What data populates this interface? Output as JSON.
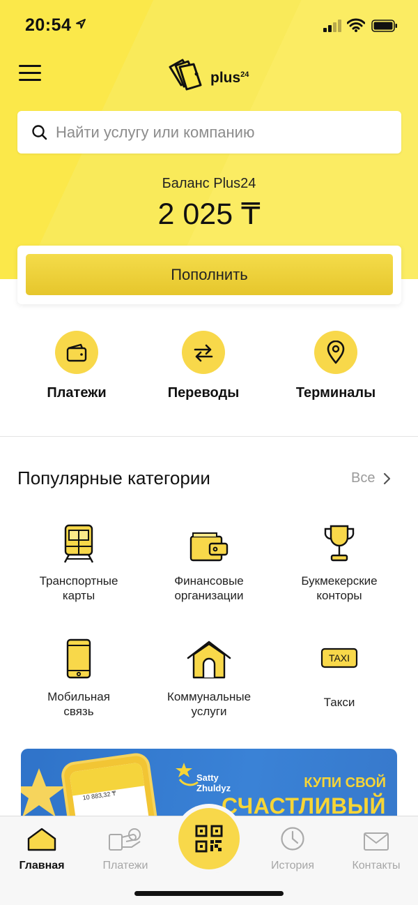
{
  "status_bar": {
    "time": "20:54"
  },
  "header": {
    "logo_text": "plus",
    "logo_sup": "24"
  },
  "search": {
    "placeholder": "Найти услугу или компанию",
    "value": ""
  },
  "balance": {
    "label": "Баланс Plus24",
    "amount": "2 025 ₸"
  },
  "topup": {
    "label": "Пополнить"
  },
  "quick_actions": [
    {
      "label": "Платежи",
      "icon": "wallet-icon"
    },
    {
      "label": "Переводы",
      "icon": "transfer-arrows-icon"
    },
    {
      "label": "Терминалы",
      "icon": "location-pin-icon"
    }
  ],
  "popular": {
    "title": "Популярные категории",
    "see_all": "Все",
    "items": [
      {
        "line1": "Транспортные",
        "line2": "карты",
        "icon": "train-icon"
      },
      {
        "line1": "Финансовые",
        "line2": "организации",
        "icon": "wallet-icon"
      },
      {
        "line1": "Букмекерские",
        "line2": "конторы",
        "icon": "trophy-icon"
      },
      {
        "line1": "Мобильная",
        "line2": "связь",
        "icon": "smartphone-icon"
      },
      {
        "line1": "Коммунальные",
        "line2": "услуги",
        "icon": "house-icon"
      },
      {
        "line1": "Такси",
        "line2": "",
        "icon": "taxi-sign-icon",
        "sign": "TAXI"
      }
    ]
  },
  "banner": {
    "brand_line1": "Satty",
    "brand_line2": "Zhuldyz",
    "headline1": "КУПИ СВОЙ",
    "headline2": "СЧАСТЛИВЫЙ",
    "phone_amount": "10 883,32 ₸"
  },
  "tabbar": {
    "items": [
      {
        "label": "Главная",
        "icon": "home-icon",
        "active": true
      },
      {
        "label": "Платежи",
        "icon": "payment-hand-icon",
        "active": false
      },
      {
        "label": "История",
        "icon": "clock-icon",
        "active": false
      },
      {
        "label": "Контакты",
        "icon": "envelope-icon",
        "active": false
      }
    ],
    "center_icon": "qr-code-icon"
  },
  "colors": {
    "accent": "#f8d84a",
    "header_bg": "#fbe84a",
    "banner_bg": "#2f73c9"
  }
}
